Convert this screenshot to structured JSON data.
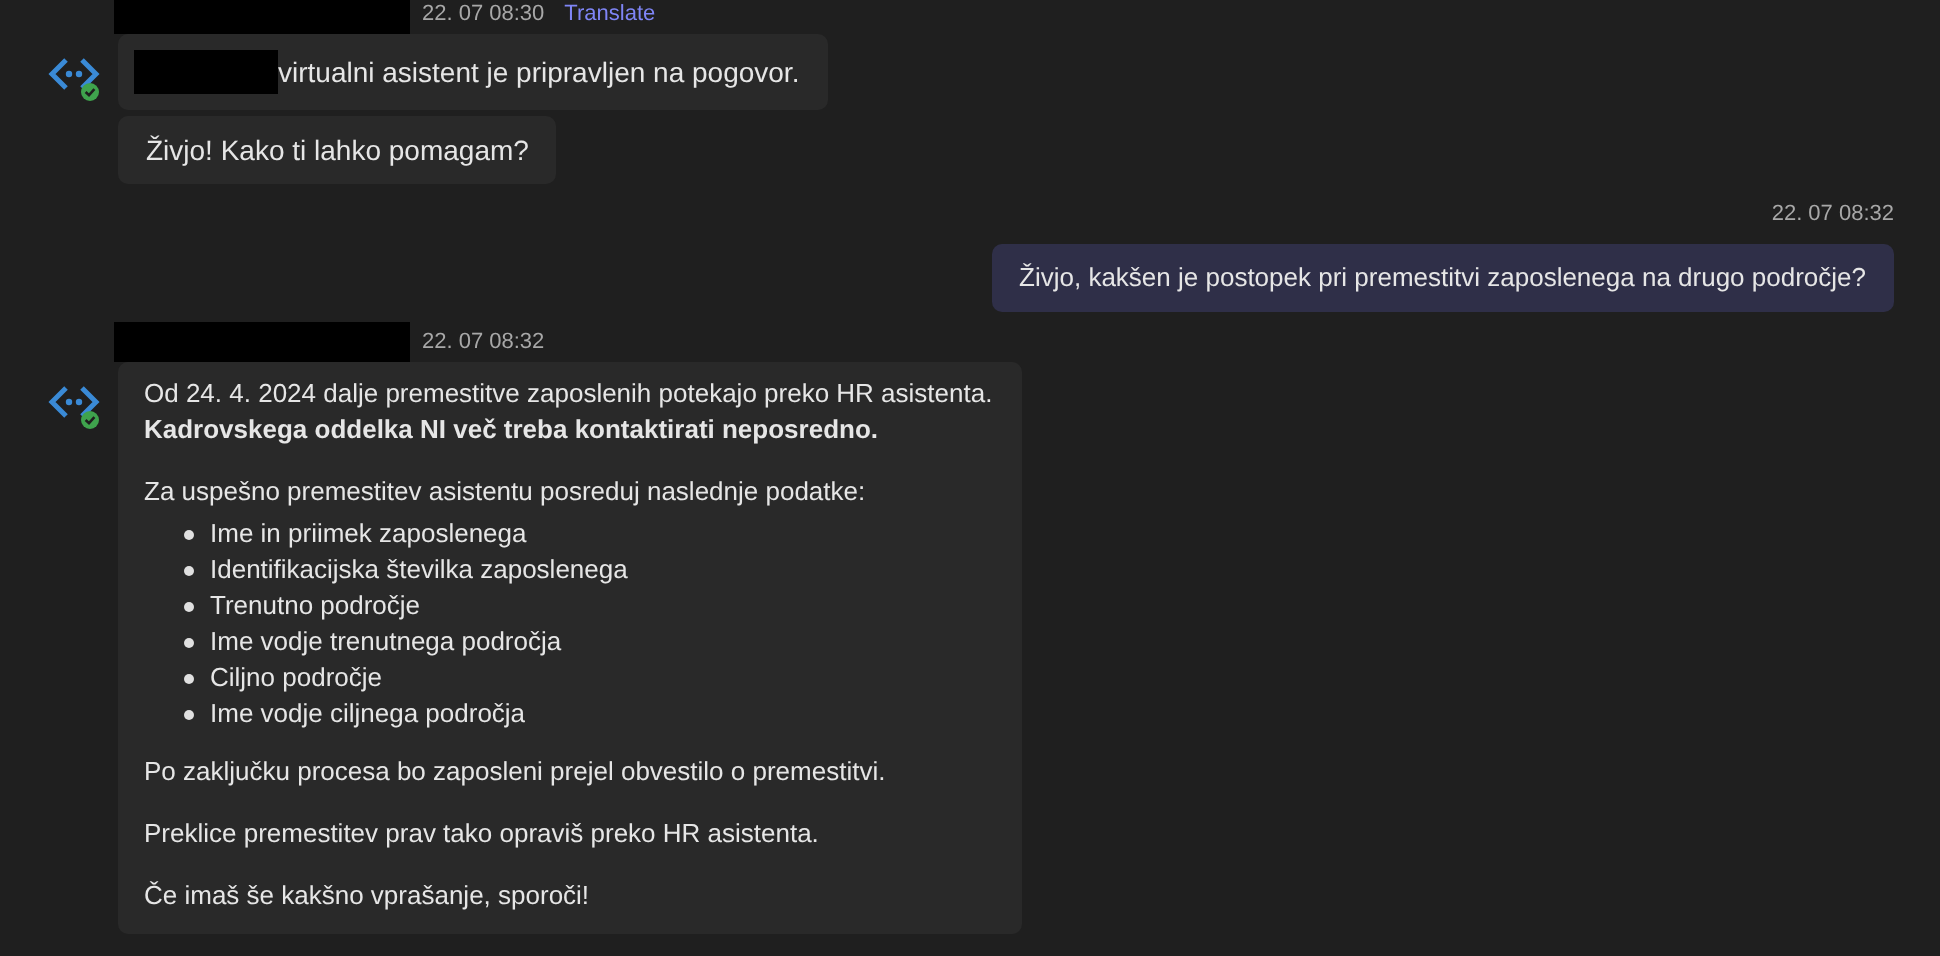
{
  "messages": [
    {
      "kind": "bot",
      "timestamp": "22. 07 08:30",
      "translate": "Translate",
      "bubbles": [
        {
          "kind": "redacted_start",
          "lines": [
            "virtualni asistent je pripravljen na pogovor."
          ]
        },
        {
          "kind": "plain",
          "lines": [
            "Živjo! Kako ti lahko pomagam?"
          ]
        }
      ]
    },
    {
      "kind": "user",
      "timestamp": "22. 07 08:32",
      "bubbles": [
        {
          "lines": [
            "Živjo, kakšen je postopek pri premestitvi zaposlenega na drugo področje?"
          ]
        }
      ]
    },
    {
      "kind": "bot",
      "timestamp": "22. 07 08:32",
      "blocks": [
        {
          "kind": "paragraph",
          "lines": [
            "Od 24. 4. 2024 dalje premestitve zaposlenih potekajo preko HR asistenta.",
            "**Kadrovskega oddelka NI več treba kontaktirati neposredno.**"
          ]
        },
        {
          "kind": "paragraph",
          "lines": [
            "Za uspešno premestitev asistentu posreduj naslednje podatke:"
          ]
        },
        {
          "kind": "list",
          "items": [
            "Ime in priimek zaposlenega",
            "Identifikacijska številka zaposlenega",
            "Trenutno področje",
            "Ime vodje trenutnega področja",
            "Ciljno področje",
            "Ime vodje ciljnega področja"
          ]
        },
        {
          "kind": "paragraph",
          "lines": [
            "Po zaključku procesa bo zaposleni prejel obvestilo o premestitvi."
          ]
        },
        {
          "kind": "paragraph",
          "lines": [
            "Preklice premestitev prav tako opraviš preko HR asistenta."
          ]
        },
        {
          "kind": "paragraph",
          "lines": [
            "Če imaš še kakšno vprašanje, sporoči!"
          ]
        }
      ]
    }
  ]
}
